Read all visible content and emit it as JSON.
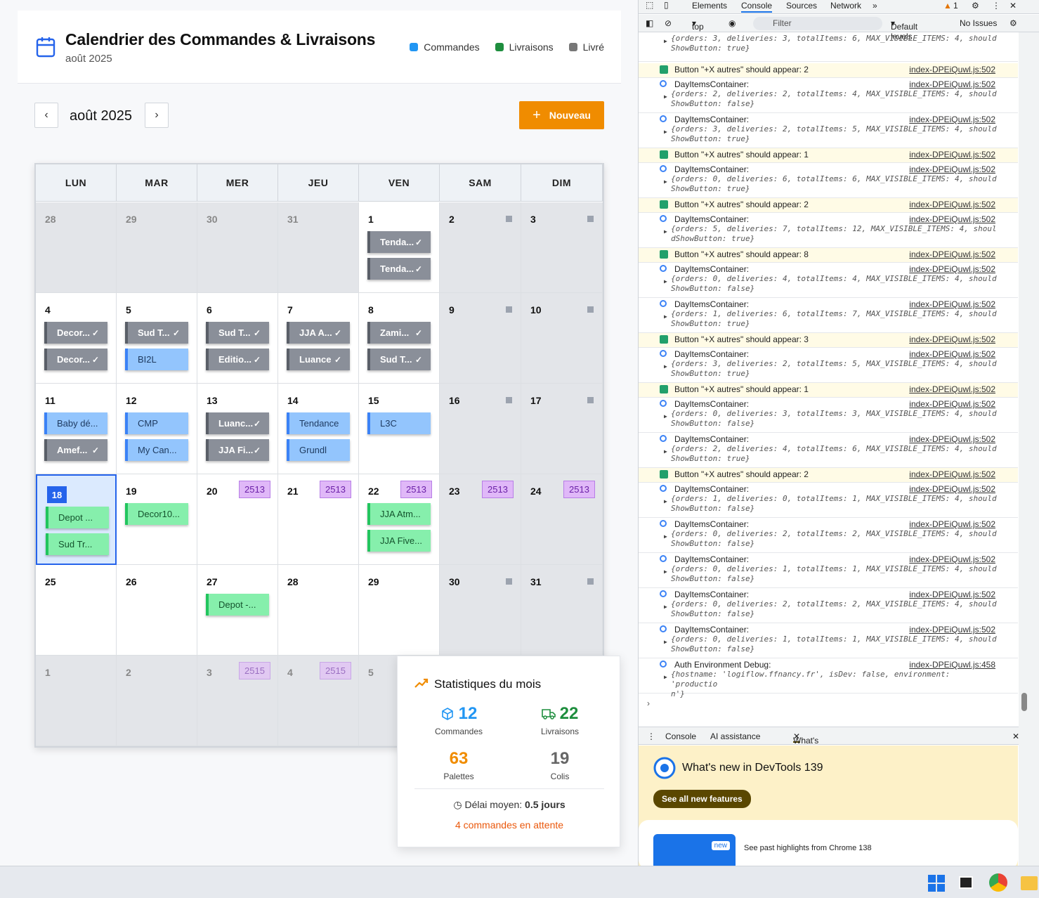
{
  "header": {
    "title": "Calendrier des Commandes & Livraisons",
    "subtitle": "août 2025"
  },
  "legend": [
    {
      "label": "Commandes",
      "color": "#2196f3"
    },
    {
      "label": "Livraisons",
      "color": "#1e8e3e"
    },
    {
      "label": "Livré",
      "color": "#777777"
    }
  ],
  "nav": {
    "month": "août 2025",
    "prev_icon": "chevron-left-icon",
    "next_icon": "chevron-right-icon",
    "new_label": "Nouveau",
    "new_icon": "+"
  },
  "weekdays": [
    "LUN",
    "MAR",
    "MER",
    "JEU",
    "VEN",
    "SAM",
    "DIM"
  ],
  "weeks": [
    [
      {
        "d": "28",
        "other": true
      },
      {
        "d": "29",
        "other": true
      },
      {
        "d": "30",
        "other": true
      },
      {
        "d": "31",
        "other": true
      },
      {
        "d": "1",
        "items": [
          {
            "t": "Tenda...",
            "k": "liv"
          },
          {
            "t": "Tenda...",
            "k": "liv"
          }
        ]
      },
      {
        "d": "2",
        "wk": true
      },
      {
        "d": "3",
        "wk": true
      }
    ],
    [
      {
        "d": "4",
        "items": [
          {
            "t": "Decor...",
            "k": "liv"
          },
          {
            "t": "Decor...",
            "k": "liv"
          }
        ]
      },
      {
        "d": "5",
        "items": [
          {
            "t": "Sud T...",
            "k": "liv"
          },
          {
            "t": "BI2L",
            "k": "cmd"
          }
        ]
      },
      {
        "d": "6",
        "items": [
          {
            "t": "Sud T...",
            "k": "liv"
          },
          {
            "t": "Editio...",
            "k": "liv"
          }
        ]
      },
      {
        "d": "7",
        "items": [
          {
            "t": "JJA A...",
            "k": "liv"
          },
          {
            "t": "Luance",
            "k": "liv"
          }
        ]
      },
      {
        "d": "8",
        "items": [
          {
            "t": "Zami...",
            "k": "liv"
          },
          {
            "t": "Sud T...",
            "k": "liv"
          }
        ]
      },
      {
        "d": "9",
        "wk": true
      },
      {
        "d": "10",
        "wk": true
      }
    ],
    [
      {
        "d": "11",
        "items": [
          {
            "t": "Baby dé...",
            "k": "cmd"
          },
          {
            "t": "Amef...",
            "k": "liv"
          }
        ]
      },
      {
        "d": "12",
        "items": [
          {
            "t": "CMP",
            "k": "cmd"
          },
          {
            "t": "My Can...",
            "k": "cmd"
          }
        ]
      },
      {
        "d": "13",
        "items": [
          {
            "t": "Luanc...",
            "k": "liv"
          },
          {
            "t": "JJA Fi...",
            "k": "liv"
          }
        ]
      },
      {
        "d": "14",
        "items": [
          {
            "t": "Tendance",
            "k": "cmd"
          },
          {
            "t": "Grundl",
            "k": "cmd"
          }
        ]
      },
      {
        "d": "15",
        "items": [
          {
            "t": "L3C",
            "k": "cmd"
          }
        ]
      },
      {
        "d": "16",
        "wk": true
      },
      {
        "d": "17",
        "wk": true
      }
    ],
    [
      {
        "d": "18",
        "today": true,
        "items": [
          {
            "t": "Depot ...",
            "k": "del"
          },
          {
            "t": "Sud Tr...",
            "k": "del"
          }
        ]
      },
      {
        "d": "19",
        "items": [
          {
            "t": "Decor10...",
            "k": "del"
          }
        ]
      },
      {
        "d": "20",
        "badge": "2513"
      },
      {
        "d": "21",
        "badge": "2513"
      },
      {
        "d": "22",
        "badge": "2513",
        "items": [
          {
            "t": "JJA Atm...",
            "k": "del"
          },
          {
            "t": "JJA Five...",
            "k": "del"
          }
        ]
      },
      {
        "d": "23",
        "wk": true,
        "badge": "2513"
      },
      {
        "d": "24",
        "wk": true,
        "badge": "2513"
      }
    ],
    [
      {
        "d": "25"
      },
      {
        "d": "26"
      },
      {
        "d": "27",
        "items": [
          {
            "t": "Depot -...",
            "k": "del"
          }
        ]
      },
      {
        "d": "28"
      },
      {
        "d": "29"
      },
      {
        "d": "30",
        "wk": true
      },
      {
        "d": "31",
        "wk": true
      }
    ],
    [
      {
        "d": "1",
        "other": true
      },
      {
        "d": "2",
        "other": true
      },
      {
        "d": "3",
        "other": true,
        "badge": "2515"
      },
      {
        "d": "4",
        "other": true,
        "badge": "2515"
      },
      {
        "d": "5",
        "other": true
      },
      {
        "d": "",
        "other": true
      },
      {
        "d": "",
        "other": true
      }
    ]
  ],
  "stats": {
    "title": "Statistiques du mois",
    "orders": {
      "value": "12",
      "label": "Commandes",
      "color": "#2196f3"
    },
    "deliveries": {
      "value": "22",
      "label": "Livraisons",
      "color": "#1e8e3e"
    },
    "pallets": {
      "value": "63",
      "label": "Palettes",
      "color": "#f08c00"
    },
    "parcels": {
      "value": "19",
      "label": "Colis",
      "color": "#666666"
    },
    "delay_label": "Délai moyen:",
    "delay_value": "0.5 jours",
    "pending": "4 commandes en attente"
  },
  "devtools": {
    "tabs": [
      "Elements",
      "Console",
      "Sources",
      "Network"
    ],
    "warn_count": "1",
    "context": "top",
    "filter_placeholder": "Filter",
    "levels": "Default levels",
    "issues": "No Issues",
    "logs": [
      {
        "type": "obj",
        "src": "",
        "obj": "{orders: 3, deliveries: 3, totalItems: 6, MAX_VISIBLE_ITEMS: 4, should\nShowButton: true}"
      },
      {
        "type": "ok",
        "text": "Button \"+X autres\" should appear: 2",
        "src": "index-DPEiQuwl.js:502"
      },
      {
        "type": "obj",
        "text": "DayItemsContainer:",
        "src": "index-DPEiQuwl.js:502",
        "obj": "{orders: 2, deliveries: 2, totalItems: 4, MAX_VISIBLE_ITEMS: 4, should\nShowButton: false}"
      },
      {
        "type": "obj",
        "text": "DayItemsContainer:",
        "src": "index-DPEiQuwl.js:502",
        "obj": "{orders: 3, deliveries: 2, totalItems: 5, MAX_VISIBLE_ITEMS: 4, should\nShowButton: true}"
      },
      {
        "type": "ok",
        "text": "Button \"+X autres\" should appear: 1",
        "src": "index-DPEiQuwl.js:502"
      },
      {
        "type": "obj",
        "text": "DayItemsContainer:",
        "src": "index-DPEiQuwl.js:502",
        "obj": "{orders: 0, deliveries: 6, totalItems: 6, MAX_VISIBLE_ITEMS: 4, should\nShowButton: true}"
      },
      {
        "type": "ok",
        "text": "Button \"+X autres\" should appear: 2",
        "src": "index-DPEiQuwl.js:502"
      },
      {
        "type": "obj",
        "text": "DayItemsContainer:",
        "src": "index-DPEiQuwl.js:502",
        "obj": "{orders: 5, deliveries: 7, totalItems: 12, MAX_VISIBLE_ITEMS: 4, shoul\ndShowButton: true}"
      },
      {
        "type": "ok",
        "text": "Button \"+X autres\" should appear: 8",
        "src": "index-DPEiQuwl.js:502"
      },
      {
        "type": "obj",
        "text": "DayItemsContainer:",
        "src": "index-DPEiQuwl.js:502",
        "obj": "{orders: 0, deliveries: 4, totalItems: 4, MAX_VISIBLE_ITEMS: 4, should\nShowButton: false}"
      },
      {
        "type": "obj",
        "text": "DayItemsContainer:",
        "src": "index-DPEiQuwl.js:502",
        "obj": "{orders: 1, deliveries: 6, totalItems: 7, MAX_VISIBLE_ITEMS: 4, should\nShowButton: true}"
      },
      {
        "type": "ok",
        "text": "Button \"+X autres\" should appear: 3",
        "src": "index-DPEiQuwl.js:502"
      },
      {
        "type": "obj",
        "text": "DayItemsContainer:",
        "src": "index-DPEiQuwl.js:502",
        "obj": "{orders: 3, deliveries: 2, totalItems: 5, MAX_VISIBLE_ITEMS: 4, should\nShowButton: true}"
      },
      {
        "type": "ok",
        "text": "Button \"+X autres\" should appear: 1",
        "src": "index-DPEiQuwl.js:502"
      },
      {
        "type": "obj",
        "text": "DayItemsContainer:",
        "src": "index-DPEiQuwl.js:502",
        "obj": "{orders: 0, deliveries: 3, totalItems: 3, MAX_VISIBLE_ITEMS: 4, should\nShowButton: false}"
      },
      {
        "type": "obj",
        "text": "DayItemsContainer:",
        "src": "index-DPEiQuwl.js:502",
        "obj": "{orders: 2, deliveries: 4, totalItems: 6, MAX_VISIBLE_ITEMS: 4, should\nShowButton: true}"
      },
      {
        "type": "ok",
        "text": "Button \"+X autres\" should appear: 2",
        "src": "index-DPEiQuwl.js:502"
      },
      {
        "type": "obj",
        "text": "DayItemsContainer:",
        "src": "index-DPEiQuwl.js:502",
        "obj": "{orders: 1, deliveries: 0, totalItems: 1, MAX_VISIBLE_ITEMS: 4, should\nShowButton: false}"
      },
      {
        "type": "obj",
        "text": "DayItemsContainer:",
        "src": "index-DPEiQuwl.js:502",
        "obj": "{orders: 0, deliveries: 2, totalItems: 2, MAX_VISIBLE_ITEMS: 4, should\nShowButton: false}"
      },
      {
        "type": "obj",
        "text": "DayItemsContainer:",
        "src": "index-DPEiQuwl.js:502",
        "obj": "{orders: 0, deliveries: 1, totalItems: 1, MAX_VISIBLE_ITEMS: 4, should\nShowButton: false}"
      },
      {
        "type": "obj",
        "text": "DayItemsContainer:",
        "src": "index-DPEiQuwl.js:502",
        "obj": "{orders: 0, deliveries: 2, totalItems: 2, MAX_VISIBLE_ITEMS: 4, should\nShowButton: false}"
      },
      {
        "type": "obj",
        "text": "DayItemsContainer:",
        "src": "index-DPEiQuwl.js:502",
        "obj": "{orders: 0, deliveries: 1, totalItems: 1, MAX_VISIBLE_ITEMS: 4, should\nShowButton: false}"
      },
      {
        "type": "obj",
        "text": "Auth Environment Debug:",
        "src": "index-DPEiQuwl.js:458",
        "obj": "{hostname: 'logiflow.ffnancy.fr', isDev: false, environment: 'productio\nn'}"
      }
    ],
    "drawer_tabs": [
      "Console",
      "AI assistance",
      "What's new"
    ],
    "whats_new": {
      "title": "What's new in DevTools 139",
      "button": "See all new features",
      "badge": "new",
      "highlight": "See past highlights from Chrome 138"
    }
  }
}
